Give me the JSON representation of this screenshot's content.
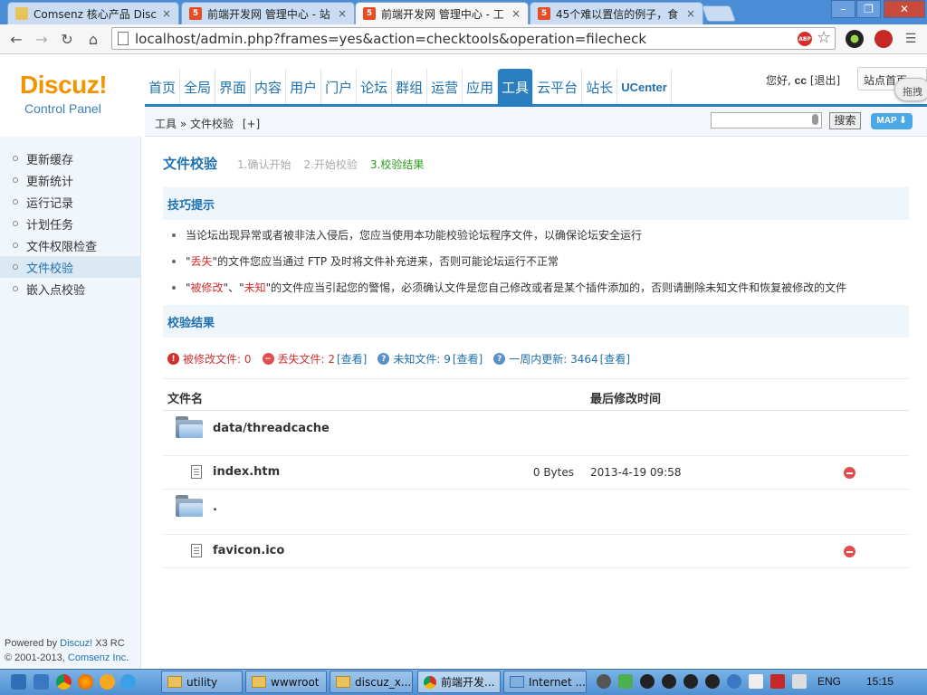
{
  "browser": {
    "tabs": [
      {
        "label": "Comsenz 核心产品 Discu",
        "color": "#e8c25a"
      },
      {
        "label": "前端开发网 管理中心 - 站",
        "color": "#e44d26"
      },
      {
        "label": "前端开发网 管理中心 - 工",
        "color": "#e44d26"
      },
      {
        "label": "45个难以置信的例子，食",
        "color": "#e44d26"
      }
    ],
    "close_glyph": "×",
    "url": "localhost/admin.php?frames=yes&action=checktools&operation=filecheck",
    "abp_label": "ABP",
    "icons": [
      "back-icon",
      "forward-icon",
      "reload-icon",
      "home-icon",
      "star-icon"
    ]
  },
  "app": {
    "logo": "Discuz!",
    "logo_sub": "Control Panel",
    "nav": [
      "首页",
      "全局",
      "界面",
      "内容",
      "用户",
      "门户",
      "论坛",
      "群组",
      "运营",
      "应用",
      "工具",
      "云平台",
      "站长",
      "UCenter"
    ],
    "nav_active_index": 10,
    "user": {
      "greeting": "您好,",
      "name": "cc",
      "logout": "[退出]"
    },
    "site_home": "站点首页",
    "drag_tag": "拖拽"
  },
  "crumbbar": {
    "path": "工具 » 文件校验",
    "add": "[+]",
    "search_placeholder": "",
    "search_button": "搜索",
    "map_button": "MAP"
  },
  "sidebar": {
    "items": [
      "更新缓存",
      "更新统计",
      "运行记录",
      "计划任务",
      "文件权限检查",
      "文件校验",
      "嵌入点校验"
    ],
    "active_index": 5,
    "powered_prefix": "Powered by ",
    "powered_link": "Discuz!",
    "powered_version": " X3 RC",
    "copyright_prefix": "© 2001-2013, ",
    "copyright_link": "Comsenz Inc."
  },
  "main": {
    "title": "文件校验",
    "steps": [
      "1.确认开始",
      "2.开始校验",
      "3.校验结果"
    ],
    "current_step": 2,
    "tips_title": "技巧提示",
    "tips": {
      "t1": "当论坛出现异常或者被非法入侵后，您应当使用本功能校验论坛程序文件，以确保论坛安全运行",
      "t2_q1": "\"",
      "t2_red": "丢失",
      "t2_rest": "\"的文件您应当通过 FTP 及时将文件补充进来，否则可能论坛运行不正常",
      "t3_q1": "\"",
      "t3_red1": "被修改",
      "t3_sep": "\"、\"",
      "t3_red2": "未知",
      "t3_rest": "\"的文件应当引起您的警惕，必须确认文件是您自己修改或者是某个插件添加的，否则请删除未知文件和恢复被修改的文件"
    },
    "result_title": "校验结果",
    "stats": {
      "modified_label": "被修改文件: 0",
      "lost_label": "丢失文件: 2",
      "lost_link": "[查看]",
      "unknown_label": "未知文件: 9",
      "unknown_link": "[查看]",
      "week_label": "一周内更新: 3464",
      "week_link": "[查看]"
    },
    "table": {
      "col_name": "文件名",
      "col_time": "最后修改时间",
      "rows": [
        {
          "type": "folder",
          "name": "data/threadcache",
          "size": "",
          "date": ""
        },
        {
          "type": "file",
          "name": "index.htm",
          "size": "0 Bytes",
          "date": "2013-4-19 09:58",
          "status": "lost"
        },
        {
          "type": "folder",
          "name": ".",
          "size": "",
          "date": ""
        },
        {
          "type": "file",
          "name": "favicon.ico",
          "size": "",
          "date": "",
          "status": "lost"
        }
      ]
    }
  },
  "taskbar": {
    "buttons": [
      "utility",
      "wwwroot",
      "discuz_x...",
      "前端开发...",
      "Internet ..."
    ],
    "lang": "ENG",
    "clock": "15:15"
  },
  "colors": {
    "accent": "#2a7dbf",
    "logo_orange": "#f29400",
    "danger": "#d32f2f",
    "success": "#2b9a1c"
  }
}
